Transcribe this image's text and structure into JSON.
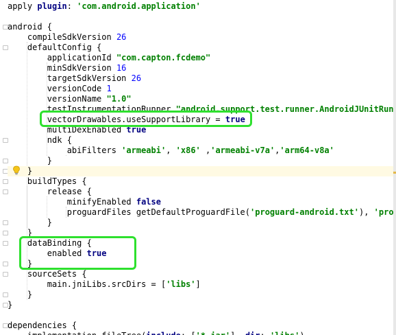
{
  "editor": {
    "lines": [
      {
        "segments": [
          {
            "t": "apply "
          },
          {
            "t": "plugin",
            "c": "kw"
          },
          {
            "t": ": "
          },
          {
            "t": "'com.android.application'",
            "c": "str"
          }
        ]
      },
      {
        "segments": []
      },
      {
        "segments": [
          {
            "t": "android {"
          }
        ]
      },
      {
        "segments": [
          {
            "t": "    compileSdkVersion "
          },
          {
            "t": "26",
            "c": "num"
          }
        ]
      },
      {
        "segments": [
          {
            "t": "    defaultConfig {"
          }
        ]
      },
      {
        "segments": [
          {
            "t": "        applicationId "
          },
          {
            "t": "\"com.capton.fcdemo\"",
            "c": "str"
          }
        ]
      },
      {
        "segments": [
          {
            "t": "        minSdkVersion "
          },
          {
            "t": "16",
            "c": "num"
          }
        ]
      },
      {
        "segments": [
          {
            "t": "        targetSdkVersion "
          },
          {
            "t": "26",
            "c": "num"
          }
        ]
      },
      {
        "segments": [
          {
            "t": "        versionCode "
          },
          {
            "t": "1",
            "c": "num"
          }
        ]
      },
      {
        "segments": [
          {
            "t": "        versionName "
          },
          {
            "t": "\"1.0\"",
            "c": "str"
          }
        ]
      },
      {
        "segments": [
          {
            "t": "        testInstrumentationRunner "
          },
          {
            "t": "\"android.support.test.runner.AndroidJUnitRunner\"",
            "c": "str"
          }
        ]
      },
      {
        "segments": [
          {
            "t": "        vectorDrawables.useSupportLibrary = "
          },
          {
            "t": "true",
            "c": "kw"
          }
        ]
      },
      {
        "segments": [
          {
            "t": "        multiDexEnabled "
          },
          {
            "t": "true",
            "c": "kw"
          }
        ]
      },
      {
        "segments": [
          {
            "t": "        ndk {"
          }
        ]
      },
      {
        "segments": [
          {
            "t": "            abiFilters "
          },
          {
            "t": "'armeabi'",
            "c": "str"
          },
          {
            "t": ", "
          },
          {
            "t": "'x86'",
            "c": "str"
          },
          {
            "t": " ,"
          },
          {
            "t": "'armeabi-v7a'",
            "c": "str"
          },
          {
            "t": ","
          },
          {
            "t": "'arm64-v8a'",
            "c": "str"
          }
        ]
      },
      {
        "segments": [
          {
            "t": "        }"
          }
        ]
      },
      {
        "segments": [
          {
            "t": "    }"
          }
        ],
        "highlight": true
      },
      {
        "segments": [
          {
            "t": "    buildTypes {"
          }
        ]
      },
      {
        "segments": [
          {
            "t": "        release {"
          }
        ]
      },
      {
        "segments": [
          {
            "t": "            minifyEnabled "
          },
          {
            "t": "false",
            "c": "kw"
          }
        ]
      },
      {
        "segments": [
          {
            "t": "            proguardFiles getDefaultProguardFile("
          },
          {
            "t": "'proguard-android.txt'",
            "c": "str"
          },
          {
            "t": "), "
          },
          {
            "t": "'proguard-rules.pro'",
            "c": "str"
          }
        ]
      },
      {
        "segments": [
          {
            "t": "        }"
          }
        ]
      },
      {
        "segments": [
          {
            "t": "    }"
          }
        ]
      },
      {
        "segments": [
          {
            "t": "    dataBinding {"
          }
        ]
      },
      {
        "segments": [
          {
            "t": "        enabled "
          },
          {
            "t": "true",
            "c": "kw"
          }
        ]
      },
      {
        "segments": [
          {
            "t": "    }"
          }
        ]
      },
      {
        "segments": [
          {
            "t": "    sourceSets {"
          }
        ]
      },
      {
        "segments": [
          {
            "t": "        main.jniLibs.srcDirs = ["
          },
          {
            "t": "'libs'",
            "c": "str"
          },
          {
            "t": "]"
          }
        ]
      },
      {
        "segments": [
          {
            "t": "    }"
          }
        ]
      },
      {
        "segments": [
          {
            "t": "}"
          }
        ]
      },
      {
        "segments": []
      },
      {
        "segments": [
          {
            "t": "dependencies {"
          }
        ]
      },
      {
        "segments": [
          {
            "t": "    implementation fileTree("
          },
          {
            "t": "include",
            "c": "kw"
          },
          {
            "t": ": ["
          },
          {
            "t": "'*.jar'",
            "c": "str"
          },
          {
            "t": "], "
          },
          {
            "t": "dir",
            "c": "kw"
          },
          {
            "t": ": "
          },
          {
            "t": "'libs'",
            "c": "str"
          },
          {
            "t": ")"
          }
        ]
      }
    ]
  },
  "colors": {
    "annotation_box": "#2ee02e",
    "keyword": "#000080",
    "string": "#008000",
    "number": "#0000ff",
    "current_line": "#fffae3"
  },
  "icons": [
    "lightbulb-icon",
    "fold-marker-icon"
  ]
}
